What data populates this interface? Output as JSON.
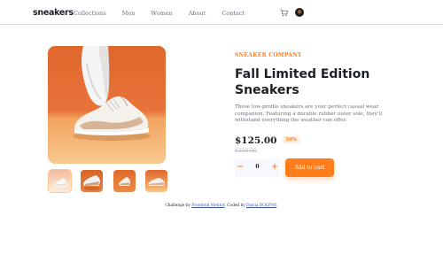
{
  "header": {
    "logo": "sneakers",
    "nav": [
      "Collections",
      "Men",
      "Women",
      "About",
      "Contact"
    ],
    "icons": [
      "cart-icon",
      "avatar"
    ]
  },
  "gallery": {
    "thumbnail_count": 4,
    "active_thumbnail": 1
  },
  "product": {
    "company": "Sneaker Company",
    "title": "Fall Limited Edition Sneakers",
    "description": "These low-profile sneakers are your perfect casual wear companion. Featuring a durable rubber outer sole, they'll withstand everything the weather can offer.",
    "price": "$125.00",
    "discount": "50%",
    "old_price": "$250.00"
  },
  "cart_controls": {
    "minus": "−",
    "quantity": "0",
    "plus": "+",
    "add_label": "Add to cart"
  },
  "footer": {
    "prefix": "Challenge by ",
    "link1": "Frontend Mentor",
    "middle": ". Coded by ",
    "link2": "Dariia DOLYNO",
    "suffix": "."
  },
  "colors": {
    "accent": "#ff7e1b",
    "dark": "#1d2026",
    "muted": "#69707d"
  }
}
